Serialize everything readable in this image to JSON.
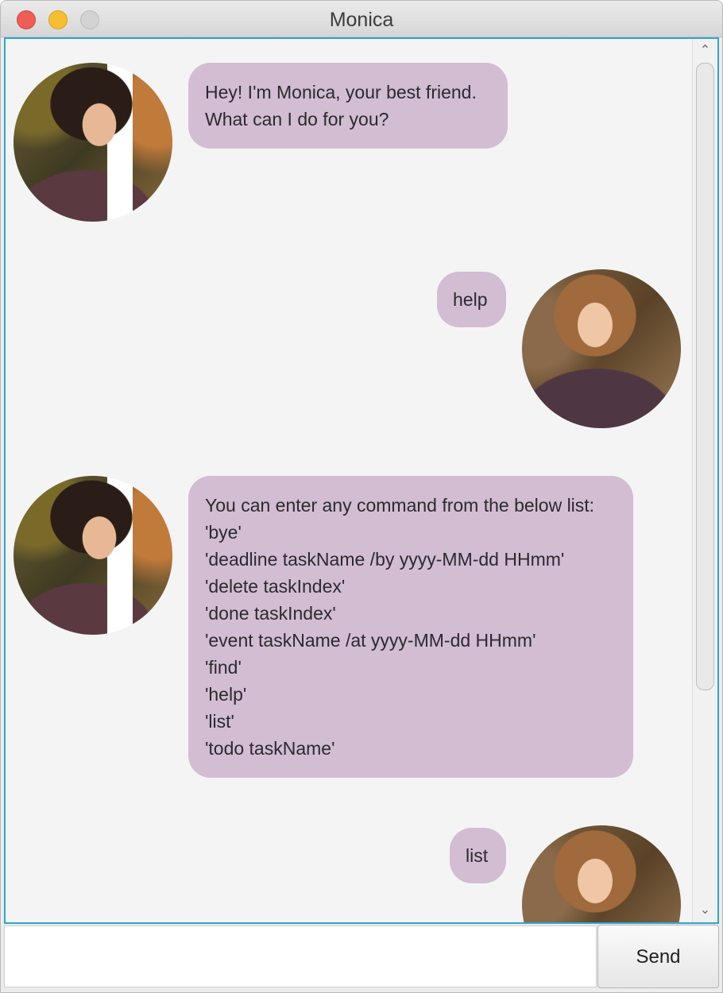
{
  "window": {
    "title": "Monica",
    "traffic_lights": [
      "close",
      "minimize",
      "zoom"
    ]
  },
  "messages": [
    {
      "sender": "bot",
      "avatar": "monica-avatar",
      "text": "Hey! I'm Monica, your best friend.\nWhat can I do for you?"
    },
    {
      "sender": "user",
      "avatar": "rachel-avatar",
      "text": "help"
    },
    {
      "sender": "bot",
      "avatar": "monica-avatar",
      "text": "You can enter any command from the below list:\n'bye'\n'deadline taskName /by yyyy-MM-dd HHmm'\n'delete taskIndex'\n'done taskIndex'\n'event taskName /at yyyy-MM-dd HHmm'\n'find'\n'help'\n'list'\n'todo taskName'"
    },
    {
      "sender": "user",
      "avatar": "rachel-avatar",
      "text": "list"
    }
  ],
  "input": {
    "value": "",
    "placeholder": ""
  },
  "send_button": {
    "label": "Send"
  },
  "colors": {
    "bubble": "#d2bdd3",
    "focus_border": "#2ea5d1",
    "pane_bg": "#f4f4f4"
  }
}
